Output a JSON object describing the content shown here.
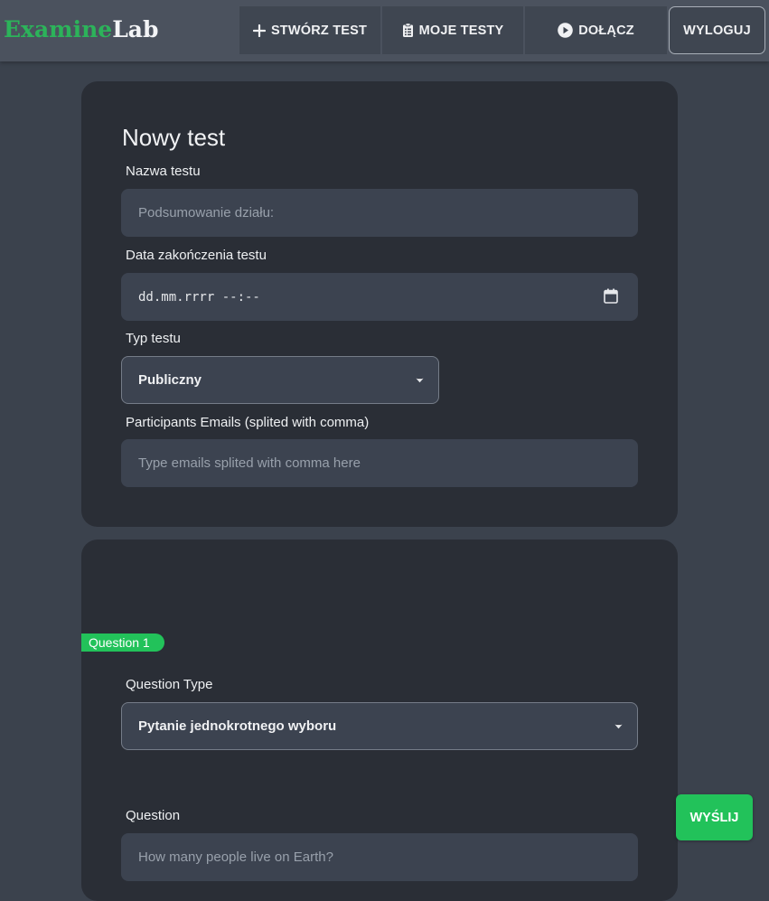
{
  "brand": {
    "part1": "Examine",
    "part2": "Lab"
  },
  "nav": {
    "create": {
      "label": "STWÓRZ TEST",
      "icon": "plus-icon"
    },
    "mytests": {
      "label": "MOJE TESTY",
      "icon": "clipboard-icon"
    },
    "join": {
      "label": "DOŁĄCZ",
      "icon": "play-circle-icon"
    },
    "logout": {
      "label": "WYLOGUJ"
    }
  },
  "test_form": {
    "title": "Nowy test",
    "name_label": "Nazwa testu",
    "name_placeholder": "Podsumowanie działu:",
    "end_date_label": "Data zakończenia testu",
    "end_date_value": "dd.mm.rrrr --:--",
    "type_label": "Typ testu",
    "type_value": "Publiczny",
    "emails_label": "Participants Emails (splited with comma)",
    "emails_placeholder": "Type emails splited with comma here"
  },
  "question": {
    "badge": "Question 1",
    "type_label": "Question Type",
    "type_value": "Pytanie jednokrotnego wyboru",
    "question_label": "Question",
    "question_placeholder": "How many people live on Earth?"
  },
  "send_label": "WYŚLIJ",
  "colors": {
    "accent": "#22c25a",
    "brand_green": "#2cb35a",
    "background": "#3b424d",
    "card": "#2a2e36",
    "navbar": "#4b525e"
  }
}
